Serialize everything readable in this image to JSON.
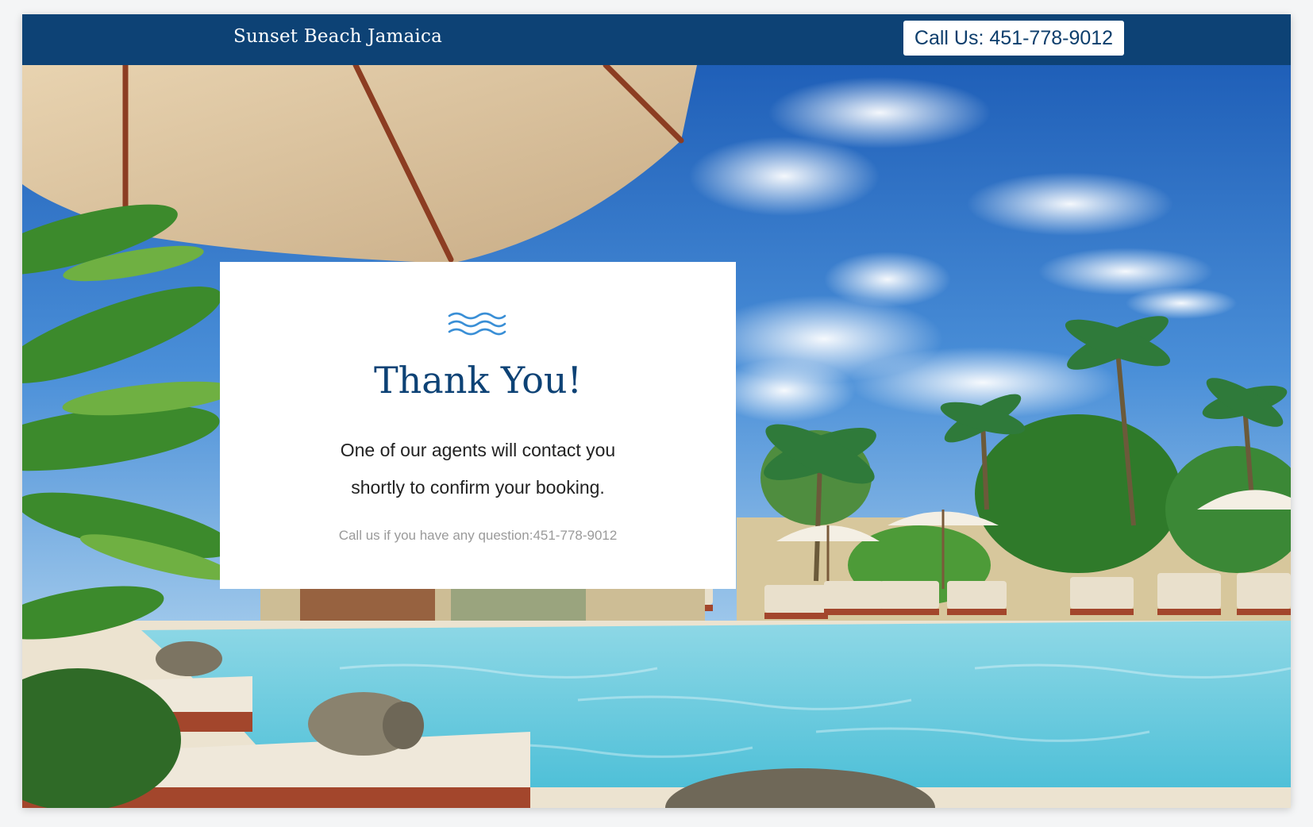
{
  "header": {
    "brand": "Sunset Beach Jamaica",
    "call_button": "Call Us: 451-778-9012"
  },
  "card": {
    "icon": "waves-icon",
    "title": "Thank You!",
    "message_line1": "One of our agents will contact you",
    "message_line2": "shortly to confirm your booking.",
    "note": "Call us if you have any question:451-778-9012"
  },
  "colors": {
    "header_bg": "#0d4275",
    "accent": "#3a8fd6",
    "title": "#0d4275",
    "note": "#9a9a9a"
  }
}
